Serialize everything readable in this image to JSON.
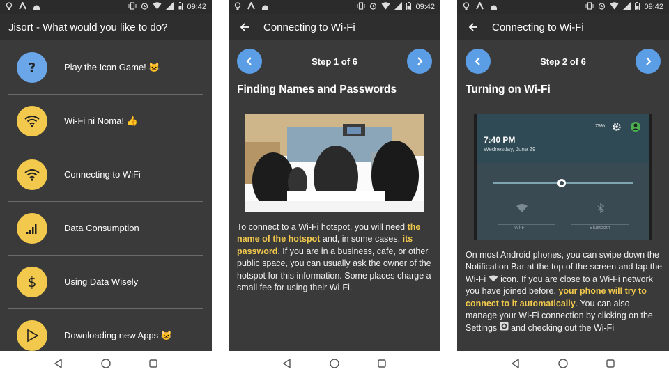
{
  "status": {
    "time": "09:42"
  },
  "screen1": {
    "title": "Jisort - What would you like to do?",
    "items": [
      {
        "label": "Play the Icon Game! 😺",
        "icon": "question-icon",
        "color": "#6aa6e8"
      },
      {
        "label": "Wi-Fi ni Noma! 👍",
        "icon": "wifi-icon",
        "color": "#f2c94c"
      },
      {
        "label": "Connecting to WiFi",
        "icon": "wifi-icon",
        "color": "#f2c94c"
      },
      {
        "label": "Data Consumption",
        "icon": "signal-bars-icon",
        "color": "#f2c94c"
      },
      {
        "label": "Using Data Wisely",
        "icon": "dollar-icon",
        "color": "#f2c94c"
      },
      {
        "label": "Downloading new Apps 😺",
        "icon": "play-store-icon",
        "color": "#f2c94c"
      }
    ]
  },
  "screen2": {
    "title": "Connecting to Wi-Fi",
    "step": "Step 1 of 6",
    "heading": "Finding Names and Passwords",
    "p1": "To connect to a Wi-Fi hotspot, you will need ",
    "hl1": "the name of the hotspot",
    "p2": " and, in some cases, ",
    "hl2": "its password",
    "p3": ". If you are in a business, cafe, or other public space, you can usually ask the owner of the hotspot for this information. Some places charge a small fee for using their Wi-Fi."
  },
  "screen3": {
    "title": "Connecting to Wi-Fi",
    "step": "Step 2 of 6",
    "heading": "Turning on Wi-Fi",
    "shot_time": "7:40 PM",
    "shot_date": "Wednesday, June 29",
    "shot_battery": "75%",
    "shot_wifi": "Wi-Fi",
    "shot_bt": "Bluetooth",
    "p1": "On most Android phones, you can swipe down the Notification Bar at the top of the screen and tap the Wi-Fi ",
    "p2": " icon. If you are close to a Wi-Fi network you have joined before, ",
    "hl1": "your phone will try to connect to it automatically",
    "p3": ". You can also manage your Wi-Fi connection by clicking on the Settings ",
    "p4": " and checking out the Wi-Fi"
  },
  "colors": {
    "accent_blue": "#5b9ee6",
    "accent_yellow": "#f2c94c",
    "bg_dark": "#3a3a3a"
  }
}
